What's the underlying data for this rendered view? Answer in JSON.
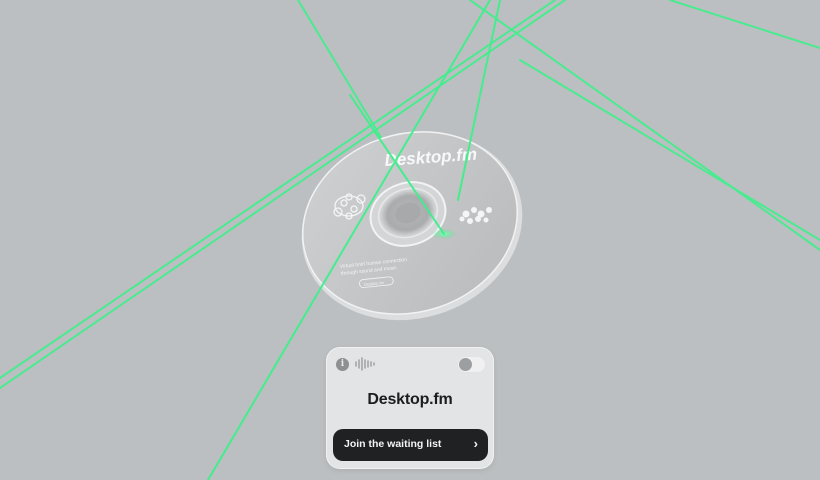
{
  "disc": {
    "brand": "Desktop.fm",
    "tagline_line1": "Virtual brief human connection",
    "tagline_line2": "through sound and music",
    "badge": "Desktop.fm"
  },
  "widget": {
    "title": "Desktop.fm",
    "cta_label": "Join the waiting list",
    "cta_chevron": "›",
    "info_icon": "info-icon",
    "wave_icon": "audio-waveform-icon",
    "toggle_state": "off"
  },
  "colors": {
    "background": "#bcbfc1",
    "laser": "#3df08a",
    "cta_bg": "#202122",
    "widget_bg": "#e3e4e5"
  }
}
